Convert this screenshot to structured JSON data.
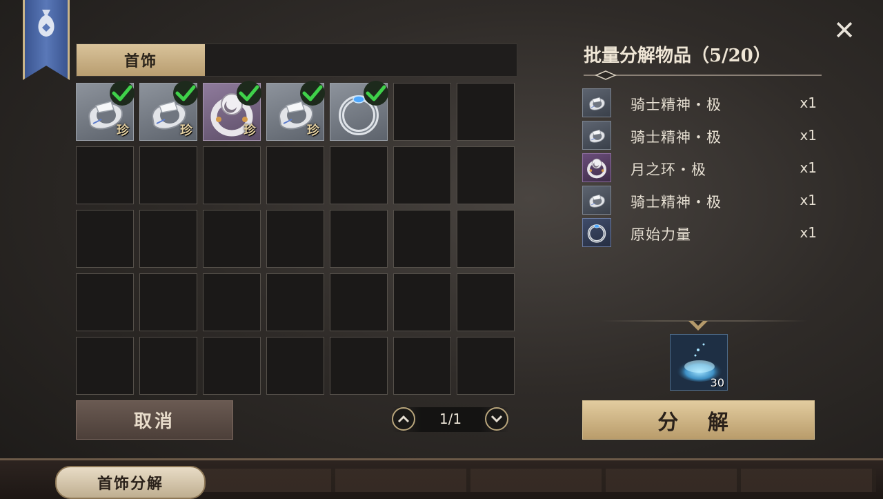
{
  "close_label": "✕",
  "tab": {
    "label": "首饰"
  },
  "grid": {
    "items": [
      {
        "kind": "silver",
        "rare": "珍",
        "checked": true
      },
      {
        "kind": "silver",
        "rare": "珍",
        "checked": true
      },
      {
        "kind": "moon",
        "rare": "珍",
        "checked": true
      },
      {
        "kind": "silver",
        "rare": "珍",
        "checked": true
      },
      {
        "kind": "blue",
        "rare": "",
        "checked": true
      }
    ]
  },
  "cancel_label": "取消",
  "pager": {
    "text": "1/1"
  },
  "panel": {
    "title": "批量分解物品（5/20）",
    "items": [
      {
        "name": "骑士精神・极",
        "qty": "x1",
        "style": "silver"
      },
      {
        "name": "骑士精神・极",
        "qty": "x1",
        "style": "silver"
      },
      {
        "name": "月之环・极",
        "qty": "x1",
        "style": "purple"
      },
      {
        "name": "骑士精神・极",
        "qty": "x1",
        "style": "silver"
      },
      {
        "name": "原始力量",
        "qty": "x1",
        "style": "blue"
      }
    ],
    "result_count": "30",
    "decompose_label": "分 解"
  },
  "footer": {
    "tab_label": "首饰分解"
  },
  "colors": {
    "accent_gold": "#d9c39a",
    "check_green": "#3fd14a"
  }
}
